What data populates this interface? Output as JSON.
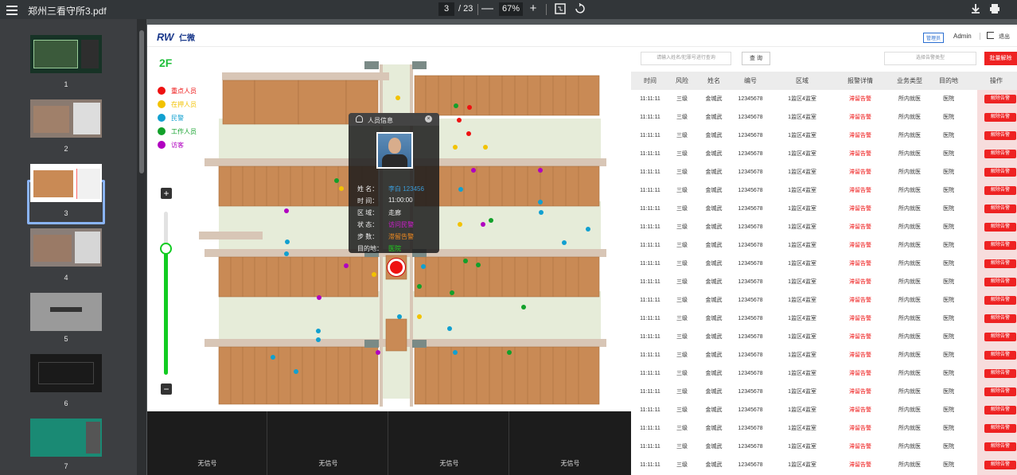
{
  "viewer": {
    "file_title": "郑州三看守所3.pdf",
    "page_current": "3",
    "page_total": "/ 23",
    "zoom": "67%",
    "zoom_out": "—",
    "zoom_in": "+",
    "icons": [
      "menu-icon",
      "fit-page-icon",
      "rotate-icon",
      "download-icon",
      "print-icon"
    ]
  },
  "thumbnails": [
    {
      "label": "1"
    },
    {
      "label": "2"
    },
    {
      "label": "3",
      "selected": true
    },
    {
      "label": "4"
    },
    {
      "label": "5"
    },
    {
      "label": "6"
    },
    {
      "label": "7"
    }
  ],
  "app": {
    "logo": "RW",
    "logo_text": "仁微",
    "role_badge": "管理员",
    "user_name": "Admin",
    "logout": "退出"
  },
  "floor": "2F",
  "legend": [
    {
      "label": "重点人员",
      "color": "#ee1111"
    },
    {
      "label": "在押人员",
      "color": "#f2c200"
    },
    {
      "label": "民警",
      "color": "#11a0d0"
    },
    {
      "label": "工作人员",
      "color": "#12a02a"
    },
    {
      "label": "访客",
      "color": "#b000c0"
    }
  ],
  "popup": {
    "title": "人员信息",
    "close": "×",
    "rows": [
      {
        "key": "姓    名：",
        "value": "李白 123456",
        "color": "#3a9bd8"
      },
      {
        "key": "时    间：",
        "value": "11:00:00",
        "color": "#eeeeee"
      },
      {
        "key": "区    域：",
        "value": "走廊",
        "color": "#eeeeee"
      },
      {
        "key": "状    态：",
        "value": "访问民警",
        "color": "#d21cd2"
      },
      {
        "key": "步    数：",
        "value": "滞留告警",
        "color": "#f08a20"
      },
      {
        "key": "目的地：",
        "value": "医院",
        "color": "#1fd01f"
      }
    ]
  },
  "search": {
    "input_placeholder": "请输入姓名/犯罪号进行查询",
    "query_button": "查 询",
    "select_placeholder": "选择告警类型",
    "batch_button": "批量解除"
  },
  "table": {
    "headers": [
      "时间",
      "风险",
      "姓名",
      "编号",
      "区域",
      "报警详情",
      "业务类型",
      "目的地",
      "操作"
    ],
    "action_label": "解除告警",
    "rows": [
      [
        "11:11:11",
        "三级",
        "金城武",
        "12345678",
        "1监区4监室",
        "滞留告警",
        "所内就医",
        "医院"
      ],
      [
        "11:11:11",
        "三级",
        "金城武",
        "12345678",
        "1监区4监室",
        "滞留告警",
        "所内就医",
        "医院"
      ],
      [
        "11:11:11",
        "三级",
        "金城武",
        "12345678",
        "1监区4监室",
        "滞留告警",
        "所内就医",
        "医院"
      ],
      [
        "11:11:11",
        "三级",
        "金城武",
        "12345678",
        "1监区4监室",
        "滞留告警",
        "所内就医",
        "医院"
      ],
      [
        "11:11:11",
        "三级",
        "金城武",
        "12345678",
        "1监区4监室",
        "滞留告警",
        "所内就医",
        "医院"
      ],
      [
        "11:11:11",
        "三级",
        "金城武",
        "12345678",
        "1监区4监室",
        "滞留告警",
        "所内就医",
        "医院"
      ],
      [
        "11:11:11",
        "三级",
        "金城武",
        "12345678",
        "1监区4监室",
        "滞留告警",
        "所内就医",
        "医院"
      ],
      [
        "11:11:11",
        "三级",
        "金城武",
        "12345678",
        "1监区4监室",
        "滞留告警",
        "所内就医",
        "医院"
      ],
      [
        "11:11:11",
        "三级",
        "金城武",
        "12345678",
        "1监区4监室",
        "滞留告警",
        "所内就医",
        "医院"
      ],
      [
        "11:11:11",
        "三级",
        "金城武",
        "12345678",
        "1监区4监室",
        "滞留告警",
        "所内就医",
        "医院"
      ],
      [
        "11:11:11",
        "三级",
        "金城武",
        "12345678",
        "1监区4监室",
        "滞留告警",
        "所内就医",
        "医院"
      ],
      [
        "11:11:11",
        "三级",
        "金城武",
        "12345678",
        "1监区4监室",
        "滞留告警",
        "所内就医",
        "医院"
      ],
      [
        "11:11:11",
        "三级",
        "金城武",
        "12345678",
        "1监区4监室",
        "滞留告警",
        "所内就医",
        "医院"
      ],
      [
        "11:11:11",
        "三级",
        "金城武",
        "12345678",
        "1监区4监室",
        "滞留告警",
        "所内就医",
        "医院"
      ],
      [
        "11:11:11",
        "三级",
        "金城武",
        "12345678",
        "1监区4监室",
        "滞留告警",
        "所内就医",
        "医院"
      ],
      [
        "11:11:11",
        "三级",
        "金城武",
        "12345678",
        "1监区4监室",
        "滞留告警",
        "所内就医",
        "医院"
      ],
      [
        "11:11:11",
        "三级",
        "金城武",
        "12345678",
        "1监区4监室",
        "滞留告警",
        "所内就医",
        "医院"
      ],
      [
        "11:11:11",
        "三级",
        "金城武",
        "12345678",
        "1监区4监室",
        "滞留告警",
        "所内就医",
        "医院"
      ],
      [
        "11:11:11",
        "三级",
        "金城武",
        "12345678",
        "1监区4监室",
        "滞留告警",
        "所内就医",
        "医院"
      ],
      [
        "11:11:11",
        "三级",
        "金城武",
        "12345678",
        "1监区4监室",
        "滞留告警",
        "所内就医",
        "医院"
      ],
      [
        "11:11:11",
        "三级",
        "金城武",
        "12345678",
        "1监区4监室",
        "滞留告警",
        "所内就医",
        "医院"
      ],
      [
        "11:11:11",
        "三级",
        "金城武",
        "12345678",
        "1监区4监室",
        "滞留告警",
        "所内就医",
        "医院"
      ]
    ]
  },
  "cameras": [
    "无信号",
    "无信号",
    "无信号",
    "无信号"
  ],
  "colors": {
    "accent_red": "#ee1111",
    "floor_green": "#1fbf3a",
    "room_brown": "#c98a55",
    "corridor": "#e6ecd9"
  }
}
